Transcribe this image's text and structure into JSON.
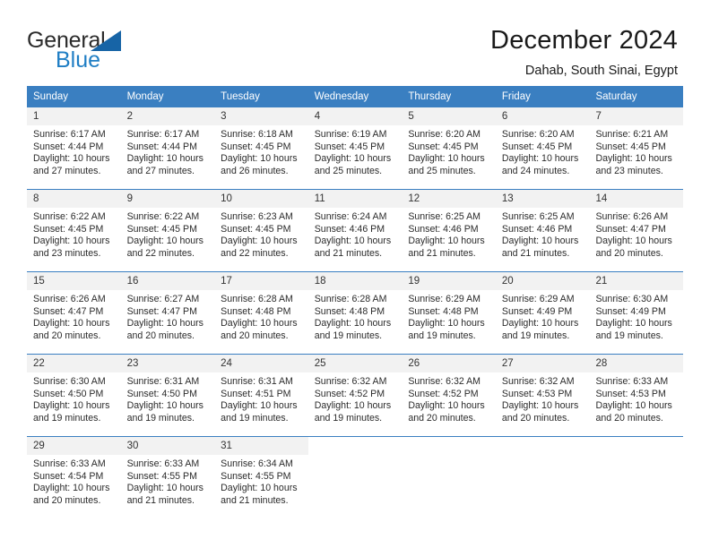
{
  "branding": {
    "logo_primary": "General",
    "logo_secondary": "Blue",
    "logo_primary_color": "#2b2b2b",
    "logo_secondary_color": "#1f7ec4",
    "logo_triangle_color": "#1764a6"
  },
  "header": {
    "title": "December 2024",
    "subtitle": "Dahab, South Sinai, Egypt"
  },
  "theme": {
    "header_row_bg": "#3a7fc1",
    "header_row_text": "#ffffff",
    "day_number_bg": "#f2f2f2",
    "cell_bg": "#ffffff",
    "text": "#2b2b2b"
  },
  "weekdays": [
    "Sunday",
    "Monday",
    "Tuesday",
    "Wednesday",
    "Thursday",
    "Friday",
    "Saturday"
  ],
  "weeks": [
    [
      {
        "day": "1",
        "sunrise": "Sunrise: 6:17 AM",
        "sunset": "Sunset: 4:44 PM",
        "daylight_line1": "Daylight: 10 hours",
        "daylight_line2": "and 27 minutes."
      },
      {
        "day": "2",
        "sunrise": "Sunrise: 6:17 AM",
        "sunset": "Sunset: 4:44 PM",
        "daylight_line1": "Daylight: 10 hours",
        "daylight_line2": "and 27 minutes."
      },
      {
        "day": "3",
        "sunrise": "Sunrise: 6:18 AM",
        "sunset": "Sunset: 4:45 PM",
        "daylight_line1": "Daylight: 10 hours",
        "daylight_line2": "and 26 minutes."
      },
      {
        "day": "4",
        "sunrise": "Sunrise: 6:19 AM",
        "sunset": "Sunset: 4:45 PM",
        "daylight_line1": "Daylight: 10 hours",
        "daylight_line2": "and 25 minutes."
      },
      {
        "day": "5",
        "sunrise": "Sunrise: 6:20 AM",
        "sunset": "Sunset: 4:45 PM",
        "daylight_line1": "Daylight: 10 hours",
        "daylight_line2": "and 25 minutes."
      },
      {
        "day": "6",
        "sunrise": "Sunrise: 6:20 AM",
        "sunset": "Sunset: 4:45 PM",
        "daylight_line1": "Daylight: 10 hours",
        "daylight_line2": "and 24 minutes."
      },
      {
        "day": "7",
        "sunrise": "Sunrise: 6:21 AM",
        "sunset": "Sunset: 4:45 PM",
        "daylight_line1": "Daylight: 10 hours",
        "daylight_line2": "and 23 minutes."
      }
    ],
    [
      {
        "day": "8",
        "sunrise": "Sunrise: 6:22 AM",
        "sunset": "Sunset: 4:45 PM",
        "daylight_line1": "Daylight: 10 hours",
        "daylight_line2": "and 23 minutes."
      },
      {
        "day": "9",
        "sunrise": "Sunrise: 6:22 AM",
        "sunset": "Sunset: 4:45 PM",
        "daylight_line1": "Daylight: 10 hours",
        "daylight_line2": "and 22 minutes."
      },
      {
        "day": "10",
        "sunrise": "Sunrise: 6:23 AM",
        "sunset": "Sunset: 4:45 PM",
        "daylight_line1": "Daylight: 10 hours",
        "daylight_line2": "and 22 minutes."
      },
      {
        "day": "11",
        "sunrise": "Sunrise: 6:24 AM",
        "sunset": "Sunset: 4:46 PM",
        "daylight_line1": "Daylight: 10 hours",
        "daylight_line2": "and 21 minutes."
      },
      {
        "day": "12",
        "sunrise": "Sunrise: 6:25 AM",
        "sunset": "Sunset: 4:46 PM",
        "daylight_line1": "Daylight: 10 hours",
        "daylight_line2": "and 21 minutes."
      },
      {
        "day": "13",
        "sunrise": "Sunrise: 6:25 AM",
        "sunset": "Sunset: 4:46 PM",
        "daylight_line1": "Daylight: 10 hours",
        "daylight_line2": "and 21 minutes."
      },
      {
        "day": "14",
        "sunrise": "Sunrise: 6:26 AM",
        "sunset": "Sunset: 4:47 PM",
        "daylight_line1": "Daylight: 10 hours",
        "daylight_line2": "and 20 minutes."
      }
    ],
    [
      {
        "day": "15",
        "sunrise": "Sunrise: 6:26 AM",
        "sunset": "Sunset: 4:47 PM",
        "daylight_line1": "Daylight: 10 hours",
        "daylight_line2": "and 20 minutes."
      },
      {
        "day": "16",
        "sunrise": "Sunrise: 6:27 AM",
        "sunset": "Sunset: 4:47 PM",
        "daylight_line1": "Daylight: 10 hours",
        "daylight_line2": "and 20 minutes."
      },
      {
        "day": "17",
        "sunrise": "Sunrise: 6:28 AM",
        "sunset": "Sunset: 4:48 PM",
        "daylight_line1": "Daylight: 10 hours",
        "daylight_line2": "and 20 minutes."
      },
      {
        "day": "18",
        "sunrise": "Sunrise: 6:28 AM",
        "sunset": "Sunset: 4:48 PM",
        "daylight_line1": "Daylight: 10 hours",
        "daylight_line2": "and 19 minutes."
      },
      {
        "day": "19",
        "sunrise": "Sunrise: 6:29 AM",
        "sunset": "Sunset: 4:48 PM",
        "daylight_line1": "Daylight: 10 hours",
        "daylight_line2": "and 19 minutes."
      },
      {
        "day": "20",
        "sunrise": "Sunrise: 6:29 AM",
        "sunset": "Sunset: 4:49 PM",
        "daylight_line1": "Daylight: 10 hours",
        "daylight_line2": "and 19 minutes."
      },
      {
        "day": "21",
        "sunrise": "Sunrise: 6:30 AM",
        "sunset": "Sunset: 4:49 PM",
        "daylight_line1": "Daylight: 10 hours",
        "daylight_line2": "and 19 minutes."
      }
    ],
    [
      {
        "day": "22",
        "sunrise": "Sunrise: 6:30 AM",
        "sunset": "Sunset: 4:50 PM",
        "daylight_line1": "Daylight: 10 hours",
        "daylight_line2": "and 19 minutes."
      },
      {
        "day": "23",
        "sunrise": "Sunrise: 6:31 AM",
        "sunset": "Sunset: 4:50 PM",
        "daylight_line1": "Daylight: 10 hours",
        "daylight_line2": "and 19 minutes."
      },
      {
        "day": "24",
        "sunrise": "Sunrise: 6:31 AM",
        "sunset": "Sunset: 4:51 PM",
        "daylight_line1": "Daylight: 10 hours",
        "daylight_line2": "and 19 minutes."
      },
      {
        "day": "25",
        "sunrise": "Sunrise: 6:32 AM",
        "sunset": "Sunset: 4:52 PM",
        "daylight_line1": "Daylight: 10 hours",
        "daylight_line2": "and 19 minutes."
      },
      {
        "day": "26",
        "sunrise": "Sunrise: 6:32 AM",
        "sunset": "Sunset: 4:52 PM",
        "daylight_line1": "Daylight: 10 hours",
        "daylight_line2": "and 20 minutes."
      },
      {
        "day": "27",
        "sunrise": "Sunrise: 6:32 AM",
        "sunset": "Sunset: 4:53 PM",
        "daylight_line1": "Daylight: 10 hours",
        "daylight_line2": "and 20 minutes."
      },
      {
        "day": "28",
        "sunrise": "Sunrise: 6:33 AM",
        "sunset": "Sunset: 4:53 PM",
        "daylight_line1": "Daylight: 10 hours",
        "daylight_line2": "and 20 minutes."
      }
    ],
    [
      {
        "day": "29",
        "sunrise": "Sunrise: 6:33 AM",
        "sunset": "Sunset: 4:54 PM",
        "daylight_line1": "Daylight: 10 hours",
        "daylight_line2": "and 20 minutes."
      },
      {
        "day": "30",
        "sunrise": "Sunrise: 6:33 AM",
        "sunset": "Sunset: 4:55 PM",
        "daylight_line1": "Daylight: 10 hours",
        "daylight_line2": "and 21 minutes."
      },
      {
        "day": "31",
        "sunrise": "Sunrise: 6:34 AM",
        "sunset": "Sunset: 4:55 PM",
        "daylight_line1": "Daylight: 10 hours",
        "daylight_line2": "and 21 minutes."
      },
      {
        "day": "",
        "sunrise": "",
        "sunset": "",
        "daylight_line1": "",
        "daylight_line2": ""
      },
      {
        "day": "",
        "sunrise": "",
        "sunset": "",
        "daylight_line1": "",
        "daylight_line2": ""
      },
      {
        "day": "",
        "sunrise": "",
        "sunset": "",
        "daylight_line1": "",
        "daylight_line2": ""
      },
      {
        "day": "",
        "sunrise": "",
        "sunset": "",
        "daylight_line1": "",
        "daylight_line2": ""
      }
    ]
  ]
}
